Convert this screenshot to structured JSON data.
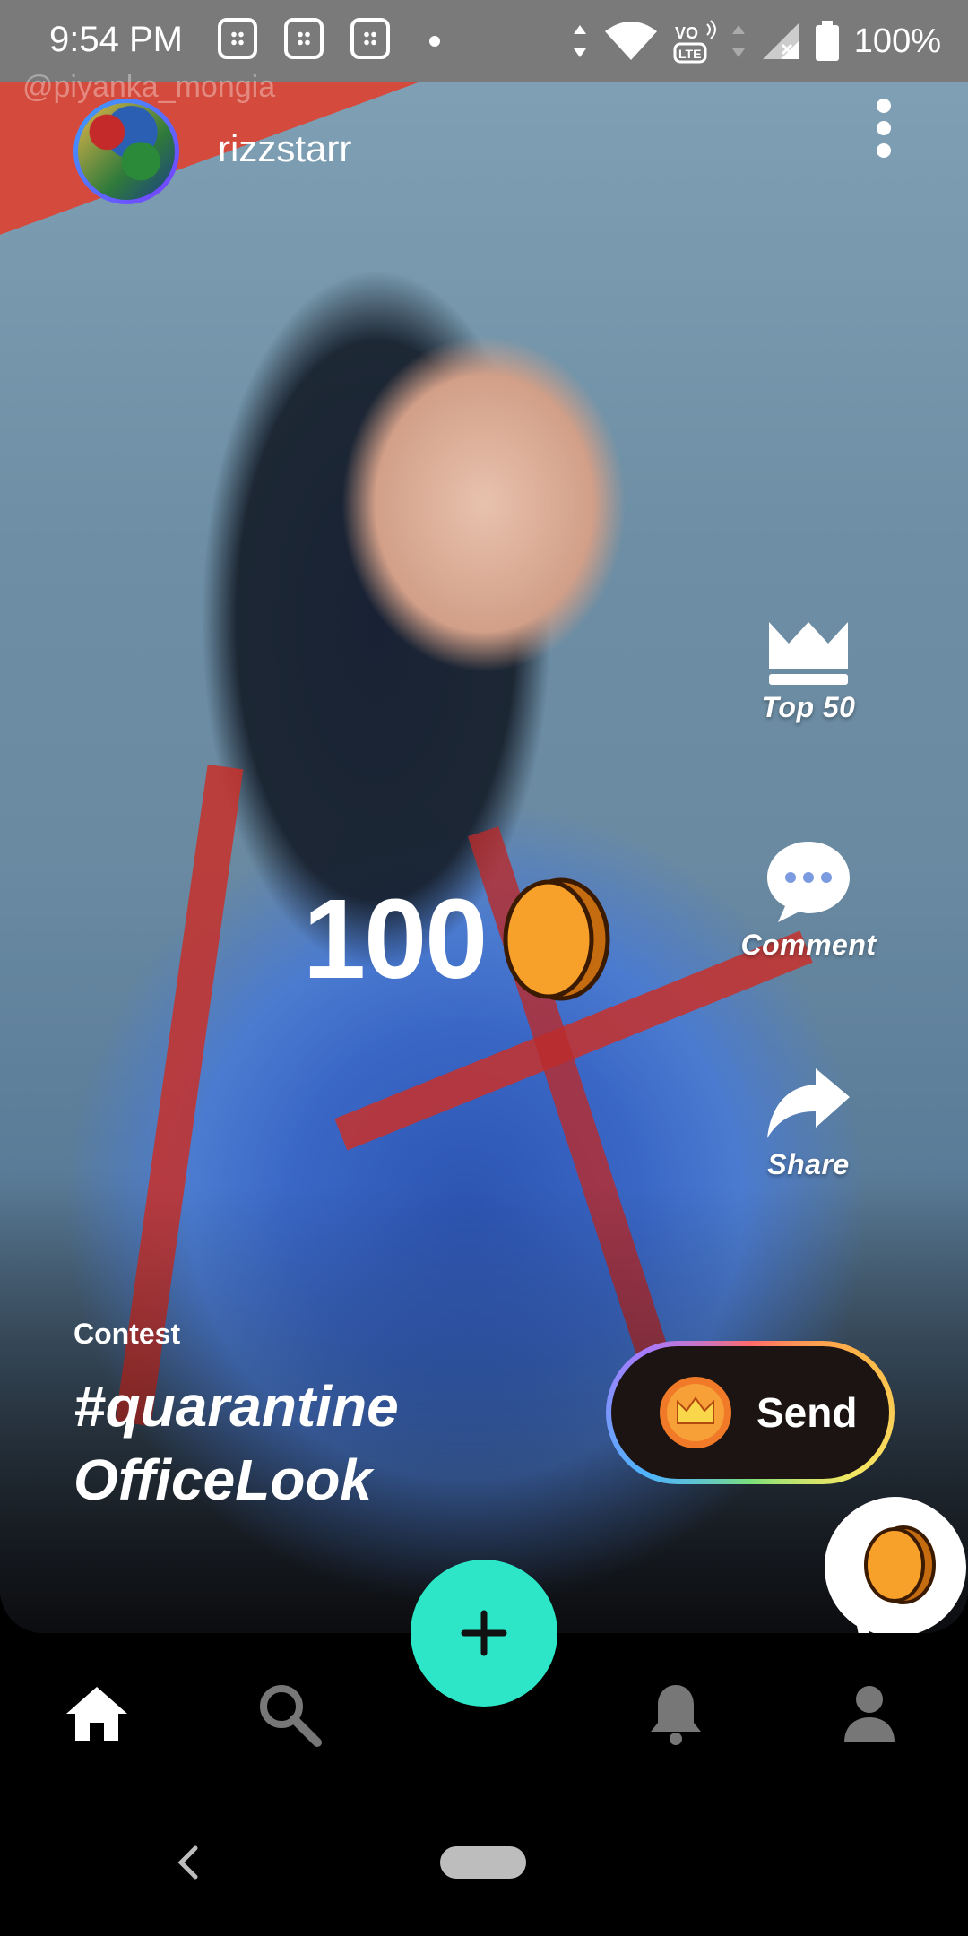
{
  "status_bar": {
    "time": "9:54 PM",
    "battery": "100%",
    "icons": [
      "notification-icon",
      "notification-icon",
      "notification-icon",
      "data-arrows-icon",
      "wifi-icon",
      "volte-icon",
      "signal-icon",
      "battery-icon"
    ]
  },
  "post": {
    "watermark": "@piyanka_mongia",
    "username": "rizzstarr",
    "coin_count": "100",
    "contest_label": "Contest",
    "contest_hashtag": "#quarantine OfficeLook"
  },
  "actions": {
    "top50": "Top 50",
    "comment": "Comment",
    "share": "Share",
    "send": "Send"
  },
  "bottom_nav": {
    "items": [
      "home-icon",
      "search-icon",
      "add-icon",
      "bell-icon",
      "profile-icon"
    ]
  },
  "colors": {
    "accent_fab": "#2de6c8",
    "coin": "#f7a02a",
    "status_bar": "#7a7a7a"
  }
}
